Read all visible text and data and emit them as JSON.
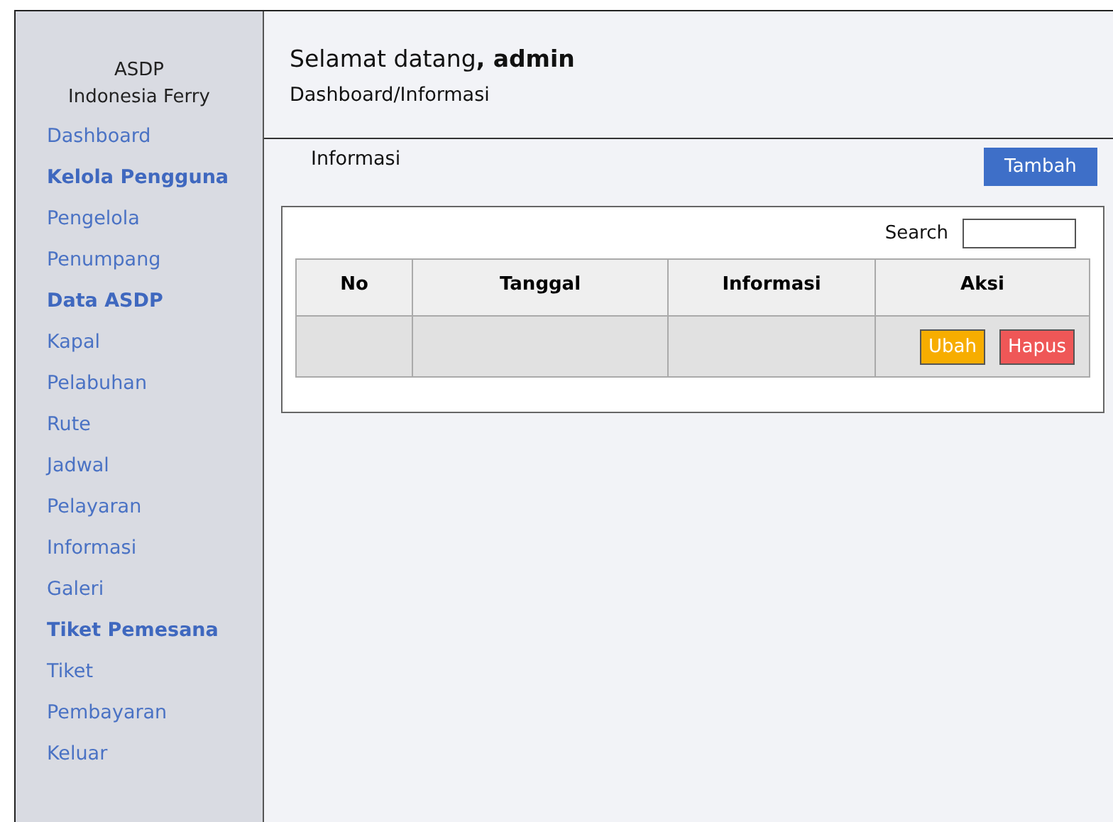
{
  "sidebar": {
    "brand": [
      "ASDP",
      "Indonesia Ferry"
    ],
    "items": [
      {
        "label": "Dashboard",
        "kind": "link"
      },
      {
        "label": "Kelola Pengguna",
        "kind": "heading"
      },
      {
        "label": "Pengelola",
        "kind": "link"
      },
      {
        "label": "Penumpang",
        "kind": "link"
      },
      {
        "label": "Data ASDP",
        "kind": "heading"
      },
      {
        "label": "Kapal",
        "kind": "link"
      },
      {
        "label": "Pelabuhan",
        "kind": "link"
      },
      {
        "label": "Rute",
        "kind": "link"
      },
      {
        "label": "Jadwal",
        "kind": "link"
      },
      {
        "label": "Pelayaran",
        "kind": "link"
      },
      {
        "label": "Informasi",
        "kind": "link"
      },
      {
        "label": "Galeri",
        "kind": "link"
      },
      {
        "label": "Tiket Pemesana",
        "kind": "heading"
      },
      {
        "label": "Tiket",
        "kind": "link"
      },
      {
        "label": "Pembayaran",
        "kind": "link"
      },
      {
        "label": "Keluar",
        "kind": "link"
      }
    ]
  },
  "header": {
    "greeting": "Selamat datang**, admin**",
    "breadcrumb": "Dashboard/Informasi"
  },
  "content": {
    "title": "Informasi",
    "add_button": "Tambah",
    "search_label": "Search",
    "table": {
      "columns": [
        "No",
        "Tanggal",
        "Informasi",
        "Aksi"
      ],
      "rows": [
        {
          "cells": [
            "",
            "",
            ""
          ],
          "actions": [
            {
              "label": "Ubah",
              "kind": "edit"
            },
            {
              "label": "Hapus",
              "kind": "delete"
            }
          ]
        }
      ]
    }
  }
}
